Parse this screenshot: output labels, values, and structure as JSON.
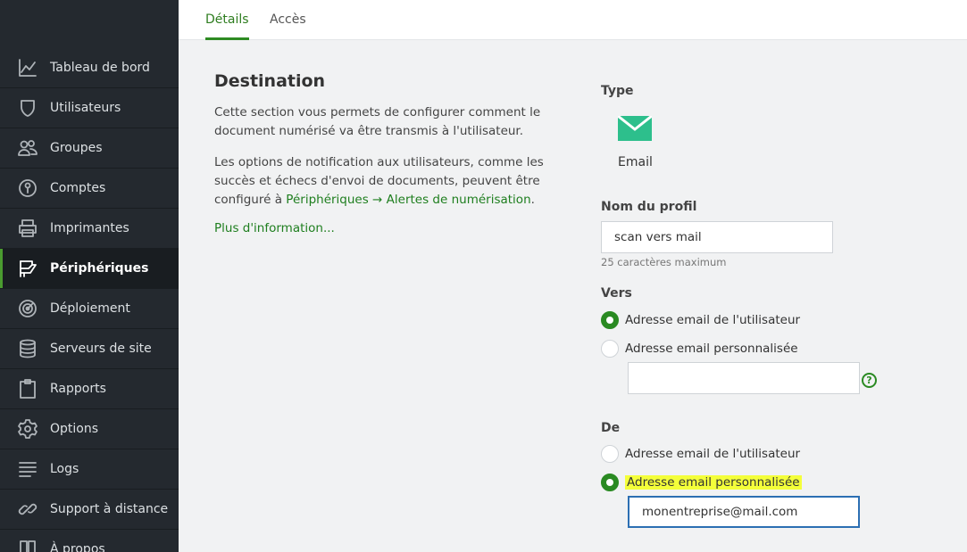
{
  "sidebar": {
    "items": [
      {
        "label": "Tableau de bord",
        "icon": "chart-line-icon"
      },
      {
        "label": "Utilisateurs",
        "icon": "user-icon"
      },
      {
        "label": "Groupes",
        "icon": "users-icon"
      },
      {
        "label": "Comptes",
        "icon": "account-icon"
      },
      {
        "label": "Imprimantes",
        "icon": "printer-icon"
      },
      {
        "label": "Périphériques",
        "icon": "device-icon"
      },
      {
        "label": "Déploiement",
        "icon": "deploy-icon"
      },
      {
        "label": "Serveurs de site",
        "icon": "database-icon"
      },
      {
        "label": "Rapports",
        "icon": "clipboard-icon"
      },
      {
        "label": "Options",
        "icon": "gear-icon"
      },
      {
        "label": "Logs",
        "icon": "lines-icon"
      },
      {
        "label": "Support à distance",
        "icon": "link-icon"
      },
      {
        "label": "À propos",
        "icon": "book-icon"
      }
    ],
    "active_index": 5
  },
  "tabs": {
    "details": "Détails",
    "access": "Accès"
  },
  "destination": {
    "title": "Destination",
    "intro": "Cette section vous permets de configurer comment le document numérisé va être transmis à l'utilisateur.",
    "notif_text": "Les options de notification aux utilisateurs, comme les succès et échecs d'envoi de documents, peuvent être configuré à ",
    "notif_link": "Périphériques → Alertes de numérisation",
    "notif_end": ".",
    "more_link": "Plus d'information..."
  },
  "type": {
    "label": "Type",
    "value": "Email"
  },
  "profile": {
    "label": "Nom du profil",
    "value": "scan vers mail",
    "hint": "25 caractères maximum"
  },
  "to": {
    "label": "Vers",
    "option_user": "Adresse email de l'utilisateur",
    "option_custom": "Adresse email personnalisée",
    "selected": "user",
    "custom_value": ""
  },
  "from": {
    "label": "De",
    "option_user": "Adresse email de l'utilisateur",
    "option_custom": "Adresse email personnalisée",
    "selected": "custom",
    "custom_value": "monentreprise@mail.com"
  },
  "colors": {
    "accent": "#2a8a22",
    "sidebar_bg": "#24292f",
    "email_icon": "#2dbf8c",
    "highlight": "#f4ff3a"
  }
}
